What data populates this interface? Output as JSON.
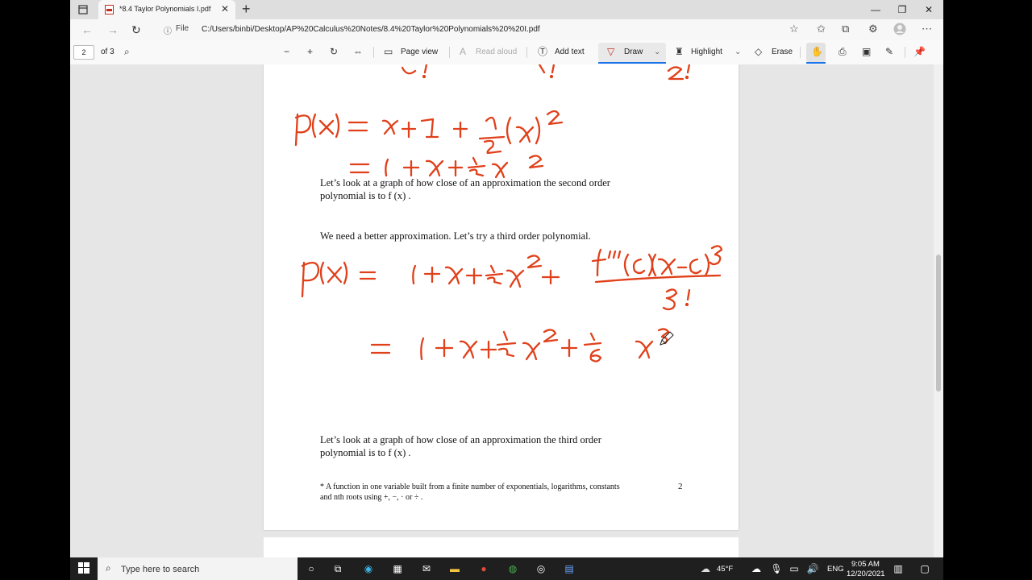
{
  "browser": {
    "tab_title": "*8.4 Taylor Polynomials I.pdf",
    "file_label": "File",
    "url": "C:/Users/binbi/Desktop/AP%20Calculus%20Notes/8.4%20Taylor%20Polynomials%20%20I.pdf"
  },
  "pdf_toolbar": {
    "page_current": "2",
    "page_total": "of 3",
    "page_view": "Page view",
    "read_aloud": "Read aloud",
    "add_text": "Add text",
    "draw": "Draw",
    "highlight": "Highlight",
    "erase": "Erase"
  },
  "document": {
    "para1_line1": "Let’s look at a graph of how close of an approximation the second order",
    "para1_line2": "polynomial is to  f (x) .",
    "para2": "We need a better approximation. Let’s try a third order polynomial.",
    "para3_line1": "Let’s look at a graph of how close of an approximation the third order",
    "para3_line2": "polynomial is to  f (x) .",
    "footnote_line1": "* A function in one variable built from a finite number of exponentials, logarithms, constants",
    "footnote_line2": "and nth roots using +, −, · or ÷ .",
    "page_number": "2",
    "ink_color": "#e0401a"
  },
  "taskbar": {
    "search_placeholder": "Type here to search",
    "weather": "45°F",
    "language": "ENG",
    "time": "9:05 AM",
    "date": "12/20/2021"
  }
}
